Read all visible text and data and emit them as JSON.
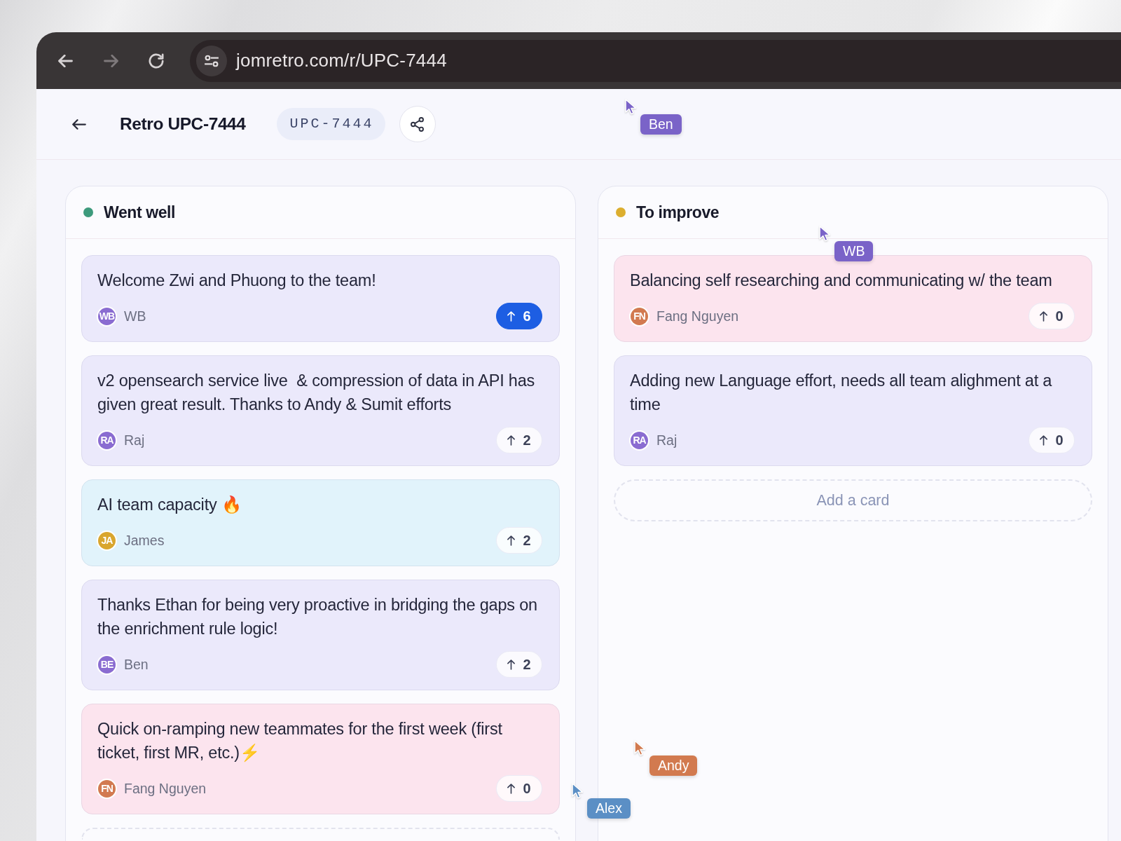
{
  "browser": {
    "nav": [
      {
        "kind": "back",
        "disabled": false
      },
      {
        "kind": "forward",
        "disabled": true
      },
      {
        "kind": "reload",
        "disabled": false
      }
    ],
    "url": "jomretro.com/r/UPC-7444"
  },
  "header": {
    "title": "Retro UPC-7444",
    "code": "UPC-7444"
  },
  "columns": [
    {
      "title": "Went well",
      "color": "#3d9a7c",
      "cards": [
        {
          "text": "Welcome Zwi and Phuong to the team!",
          "color": "#ebe9fb",
          "author": {
            "initials": "WB",
            "name": "WB",
            "color": "#8a6cd1"
          },
          "votes": "6",
          "voted": true
        },
        {
          "text": "v2 opensearch service live  & compression of data in API has given great result. Thanks to Andy & Sumit efforts",
          "color": "#ebe9fb",
          "author": {
            "initials": "RA",
            "name": "Raj",
            "color": "#8a6cd1"
          },
          "votes": "2",
          "voted": false
        },
        {
          "text": "AI team capacity 🔥",
          "color": "#e1f3fb",
          "author": {
            "initials": "JA",
            "name": "James",
            "color": "#d9a62e"
          },
          "votes": "2",
          "voted": false
        },
        {
          "text": "Thanks Ethan for being very proactive in bridging the gaps on the enrichment rule logic!",
          "color": "#ebe9fb",
          "author": {
            "initials": "BE",
            "name": "Ben",
            "color": "#8a6cd1"
          },
          "votes": "2",
          "voted": false
        },
        {
          "text": "Quick on-ramping new teammates for the first week (first ticket, first MR, etc.)⚡",
          "color": "#fce4ee",
          "author": {
            "initials": "FN",
            "name": "Fang Nguyen",
            "color": "#d27a50"
          },
          "votes": "0",
          "voted": false
        }
      ],
      "add_card": {
        "kind": "edge"
      }
    },
    {
      "title": "To improve",
      "color": "#dcae2f",
      "cards": [
        {
          "text": "Balancing self researching and communicating w/ the team",
          "color": "#fce4ee",
          "author": {
            "initials": "FN",
            "name": "Fang Nguyen",
            "color": "#d27a50"
          },
          "votes": "0",
          "voted": false
        },
        {
          "text": "Adding new Language effort, needs all team alighment at a time",
          "color": "#ebe9fb",
          "author": {
            "initials": "RA",
            "name": "Raj",
            "color": "#8a6cd1"
          },
          "votes": "0",
          "voted": false
        }
      ],
      "add_card": {
        "kind": "full",
        "label": "Add a card"
      }
    }
  ],
  "cursors": [
    {
      "name": "Ben",
      "color": "#7a63c8"
    },
    {
      "name": "WB",
      "color": "#7a63c8"
    },
    {
      "name": "Andy",
      "color": "#d27a4f"
    },
    {
      "name": "Alex",
      "color": "#5b8fc5"
    }
  ]
}
